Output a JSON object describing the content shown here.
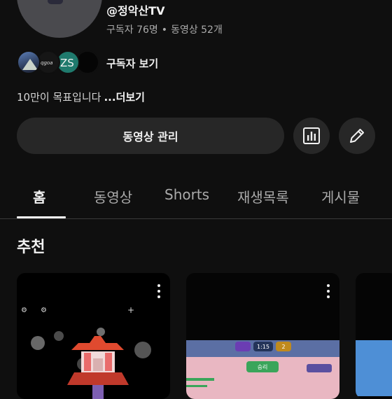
{
  "channel": {
    "handle": "@정악산TV",
    "subscribers": "구독자 76명",
    "separator": "•",
    "videos": "동영상 52개",
    "view_subscribers_label": "구독자 보기",
    "subscriber_avatars": [
      {
        "name": "subscriber-avatar-mountain",
        "text": ""
      },
      {
        "name": "subscriber-avatar-script",
        "text": "qgoa"
      },
      {
        "name": "subscriber-avatar-zs",
        "text": "ZS"
      },
      {
        "name": "subscriber-avatar-dark",
        "text": ""
      }
    ],
    "description": "10만이 목표입니다",
    "more_label": "...더보기"
  },
  "actions": {
    "manage_videos_label": "동영상 관리",
    "analytics_icon": "bar-chart-icon",
    "edit_icon": "pencil-icon"
  },
  "tabs": [
    {
      "label": "홈",
      "active": true
    },
    {
      "label": "동영상",
      "active": false
    },
    {
      "label": "Shorts",
      "active": false
    },
    {
      "label": "재생목록",
      "active": false
    },
    {
      "label": "게시물",
      "active": false
    }
  ],
  "section": {
    "title": "추천"
  },
  "shorts": [
    {
      "game_hud": [
        "⚙",
        "+"
      ]
    },
    {
      "game_hud": [
        "1:15",
        "승리",
        "2"
      ]
    },
    {
      "game_hud": []
    }
  ],
  "colors": {
    "background": "#0f0f0f",
    "surface": "#272727",
    "text_primary": "#f1f1f1",
    "text_secondary": "#aaaaaa",
    "accent_teal": "#1f7a6d"
  }
}
